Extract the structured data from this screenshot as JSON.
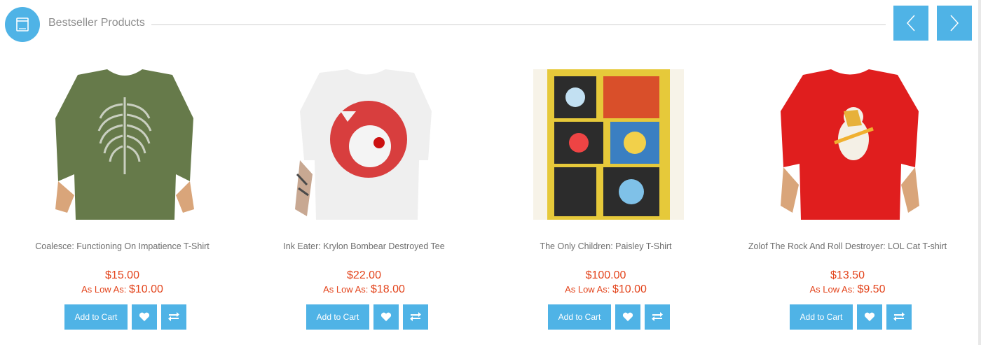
{
  "section": {
    "title": "Bestseller Products"
  },
  "colors": {
    "accent": "#4fb3e6",
    "price": "#e3441c"
  },
  "products": [
    {
      "name": "Coalesce: Functioning On Impatience T-Shirt",
      "price": "$15.00",
      "low_label": "As Low As:",
      "low_price": "$10.00",
      "add_to_cart": "Add to Cart"
    },
    {
      "name": "Ink Eater: Krylon Bombear Destroyed Tee",
      "price": "$22.00",
      "low_label": "As Low As:",
      "low_price": "$18.00",
      "add_to_cart": "Add to Cart"
    },
    {
      "name": "The Only Children: Paisley T-Shirt",
      "price": "$100.00",
      "low_label": "As Low As:",
      "low_price": "$10.00",
      "add_to_cart": "Add to Cart"
    },
    {
      "name": "Zolof The Rock And Roll Destroyer: LOL Cat T-shirt",
      "price": "$13.50",
      "low_label": "As Low As:",
      "low_price": "$9.50",
      "add_to_cart": "Add to Cart"
    }
  ]
}
